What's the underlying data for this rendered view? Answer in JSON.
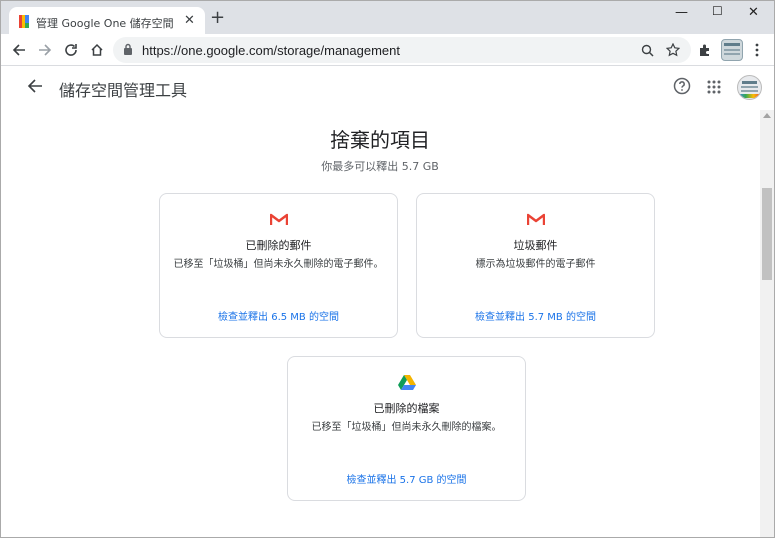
{
  "browser": {
    "tab_title": "管理 Google One 儲存空間",
    "url": "https://one.google.com/storage/management"
  },
  "app": {
    "title": "儲存空間管理工具"
  },
  "section": {
    "heading": "捨棄的項目",
    "subheading": "你最多可以釋出 5.7 GB"
  },
  "cards": [
    {
      "icon": "gmail-icon",
      "title": "已刪除的郵件",
      "desc": "已移至「垃圾桶」但尚未永久刪除的電子郵件。",
      "link": "檢查並釋出 6.5 MB 的空間"
    },
    {
      "icon": "gmail-icon",
      "title": "垃圾郵件",
      "desc": "標示為垃圾郵件的電子郵件",
      "link": "檢查並釋出 5.7 MB 的空間"
    },
    {
      "icon": "google-drive-icon",
      "title": "已刪除的檔案",
      "desc": "已移至「垃圾桶」但尚未永久刪除的檔案。",
      "link": "檢查並釋出 5.7 GB 的空間"
    }
  ],
  "colors": {
    "link": "#1a73e8",
    "gmail_red": "#ea4335",
    "drive_green": "#0f9d58",
    "drive_yellow": "#f4b400",
    "drive_blue": "#4285f4"
  }
}
